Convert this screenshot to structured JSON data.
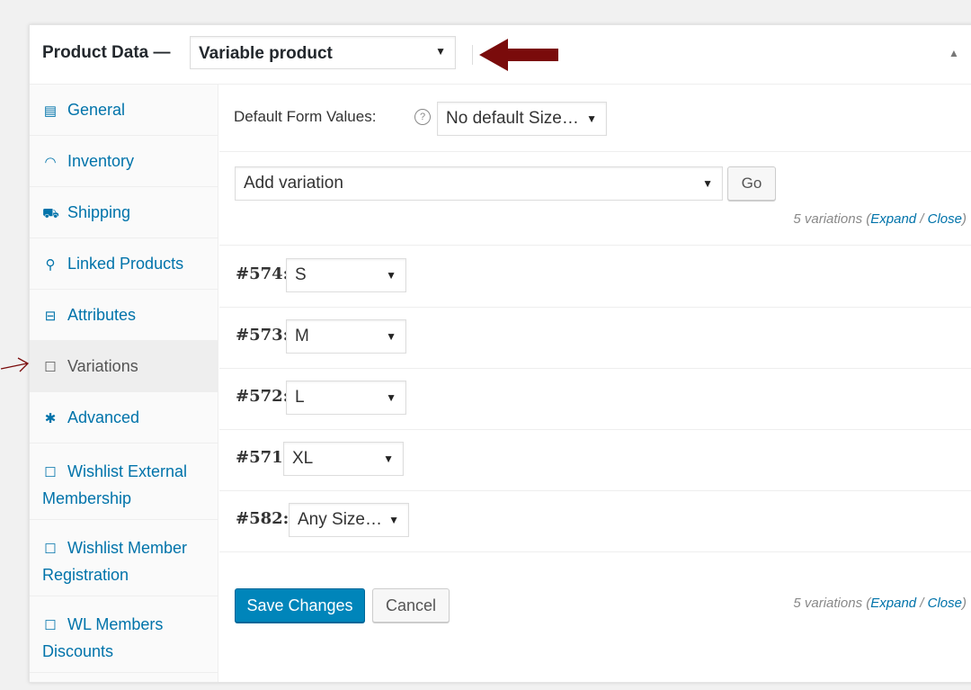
{
  "header": {
    "title": "Product Data —",
    "product_type": "Variable product"
  },
  "colors": {
    "accent": "#0073aa",
    "primary_button": "#0085ba",
    "annotation_arrow": "#7a0b0b"
  },
  "sidebar": {
    "items": [
      {
        "label": "General",
        "icon": "general-icon"
      },
      {
        "label": "Inventory",
        "icon": "inventory-icon"
      },
      {
        "label": "Shipping",
        "icon": "shipping-icon"
      },
      {
        "label": "Linked Products",
        "icon": "link-icon"
      },
      {
        "label": "Attributes",
        "icon": "attributes-icon"
      },
      {
        "label": "Variations",
        "icon": "window-icon"
      },
      {
        "label": "Advanced",
        "icon": "gear-icon"
      },
      {
        "label": "Wishlist External Membership",
        "icon": "window-icon"
      },
      {
        "label": "Wishlist Member Registration",
        "icon": "window-icon"
      },
      {
        "label": "WL Members Discounts",
        "icon": "window-icon"
      }
    ]
  },
  "main": {
    "default_form_label": "Default Form Values:",
    "default_size_value": "No default Size…",
    "add_variation_value": "Add variation",
    "go_label": "Go",
    "count_text": "5 variations",
    "expand_label": "Expand",
    "separator": "/",
    "close_label": "Close",
    "variations": [
      {
        "id": "#574:",
        "size": "S"
      },
      {
        "id": "#573:",
        "size": "M"
      },
      {
        "id": "#572:",
        "size": "L"
      },
      {
        "id": "#571:",
        "size": "XL"
      },
      {
        "id": "#582:",
        "size": "Any Size…"
      }
    ],
    "save_label": "Save Changes",
    "cancel_label": "Cancel"
  }
}
